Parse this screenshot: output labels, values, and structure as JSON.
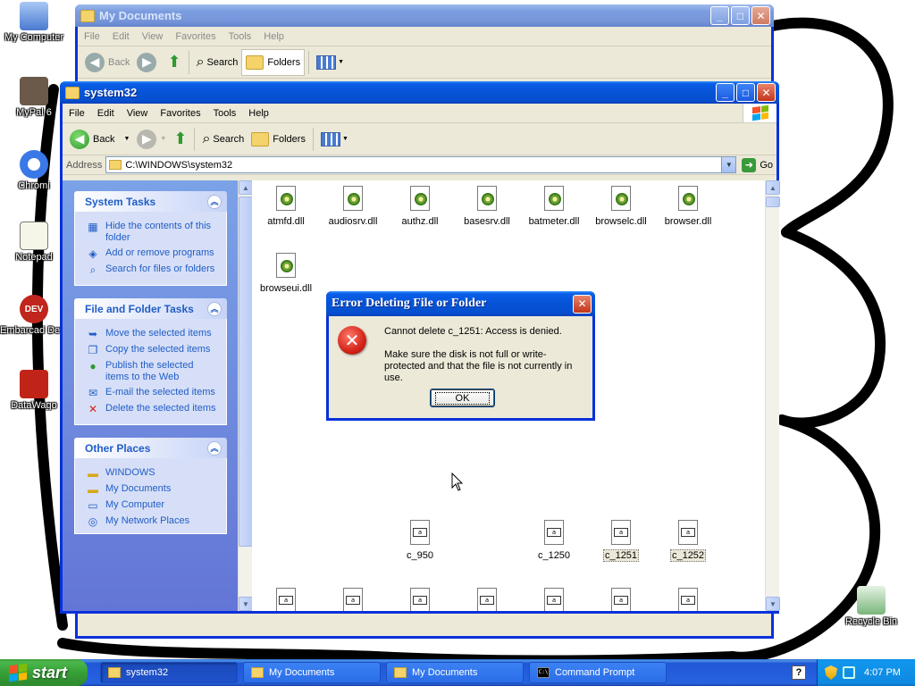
{
  "desktop": {
    "icons": [
      {
        "label": "My Computer"
      },
      {
        "label": "MyPal 6"
      },
      {
        "label": "Chromi"
      },
      {
        "label": "Notepad"
      },
      {
        "label": "Embarcad Dev-C"
      },
      {
        "label": "DataWago"
      },
      {
        "label": "Recycle Bin"
      }
    ]
  },
  "back_window": {
    "title": "My Documents",
    "menu": [
      "File",
      "Edit",
      "View",
      "Favorites",
      "Tools",
      "Help"
    ],
    "toolbar": {
      "back": "Back",
      "search": "Search",
      "folders": "Folders"
    }
  },
  "main_window": {
    "title": "system32",
    "menu": [
      "File",
      "Edit",
      "View",
      "Favorites",
      "Tools",
      "Help"
    ],
    "toolbar": {
      "back": "Back",
      "search": "Search",
      "folders": "Folders"
    },
    "address": {
      "label": "Address",
      "value": "C:\\WINDOWS\\system32",
      "go": "Go"
    },
    "task_pane": {
      "system_tasks": {
        "title": "System Tasks",
        "items": [
          "Hide the contents of this folder",
          "Add or remove programs",
          "Search for files or folders"
        ]
      },
      "file_folder_tasks": {
        "title": "File and Folder Tasks",
        "items": [
          "Move the selected items",
          "Copy the selected items",
          "Publish the selected items to the Web",
          "E-mail the selected items",
          "Delete the selected items"
        ]
      },
      "other_places": {
        "title": "Other Places",
        "items": [
          "WINDOWS",
          "My Documents",
          "My Computer",
          "My Network Places"
        ]
      }
    },
    "files": {
      "row1": [
        "atmfd.dll",
        "audiosrv.dll",
        "authz.dll",
        "basesrv.dll",
        "batmeter.dll",
        "browselc.dll",
        "browser.dll"
      ],
      "row2": [
        "browseui.dll"
      ],
      "row3": [
        "c_950",
        "c_1250",
        "c_1251",
        "c_1252"
      ]
    }
  },
  "dialog": {
    "title": "Error Deleting File or Folder",
    "message1": "Cannot delete c_1251: Access is denied.",
    "message2": "Make sure the disk is not full or write-protected and that the file is not currently in use.",
    "ok": "OK"
  },
  "taskbar": {
    "start": "start",
    "tasks": [
      {
        "label": "system32",
        "active": true
      },
      {
        "label": "My Documents",
        "active": false
      },
      {
        "label": "My Documents",
        "active": false
      },
      {
        "label": "Command Prompt",
        "active": false
      }
    ],
    "clock": "4:07 PM"
  },
  "colors": {
    "title_active": "#0a5ee8",
    "taskbar": "#2663e0",
    "start_green": "#37a037",
    "task_link": "#215dc6"
  }
}
